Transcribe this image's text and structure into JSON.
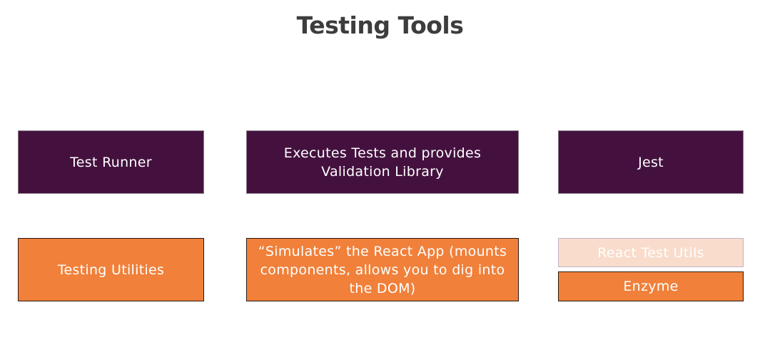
{
  "title": "Testing Tools",
  "rows": [
    {
      "category": "Test Runner",
      "description": "Executes Tests and provides Validation Library",
      "tool": "Jest"
    },
    {
      "category": "Testing Utilities",
      "description": "“Simulates” the React App (mounts components, allows you to dig into the DOM)",
      "tools": [
        "React Test Utils",
        "Enzyme"
      ]
    }
  ],
  "colors": {
    "title_text": "#3d3d3d",
    "runner_row": "#44113f",
    "utilities_row": "#f0803a",
    "utilities_row_faded": "#f9dccb"
  }
}
